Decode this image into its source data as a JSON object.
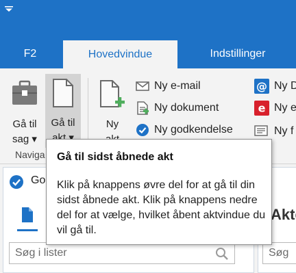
{
  "colors": {
    "accent": "#1e72c6",
    "add_green": "#4fae5d",
    "mail_red": "#d8202c"
  },
  "tabs": [
    {
      "label": "F2"
    },
    {
      "label": "Hovedvindue",
      "active": true
    },
    {
      "label": "Indstillinger"
    }
  ],
  "ribbon": {
    "ga_til_sag": {
      "line1": "Gå til",
      "line2": "sag ▾",
      "icon": "briefcase-icon"
    },
    "ga_til_akt": {
      "line1": "Gå til",
      "line2": "akt ▾",
      "icon": "document-icon"
    },
    "ny_akt": {
      "line1": "Ny",
      "line2": "akt",
      "icon": "new-document-icon"
    },
    "group_navigate": "Naviga",
    "ny_email": "Ny e-mail",
    "ny_dokument": "Ny dokument",
    "ny_godkendelse": "Ny godkendelse",
    "ny_d": "Ny D",
    "ny_e": "Ny e",
    "ny_f": "Ny f"
  },
  "panel_left": {
    "tab_label": "Go",
    "search_placeholder": "Søg i lister"
  },
  "panel_right": {
    "heading": "Akte",
    "search_placeholder": "Søg"
  },
  "tooltip": {
    "title": "Gå til sidst åbnede akt",
    "body": "Klik på knappens øvre del for at gå til din sidst åbnede akt. Klik på knappens nedre del for at vælge, hvilket åbent aktvindue du vil gå til."
  }
}
